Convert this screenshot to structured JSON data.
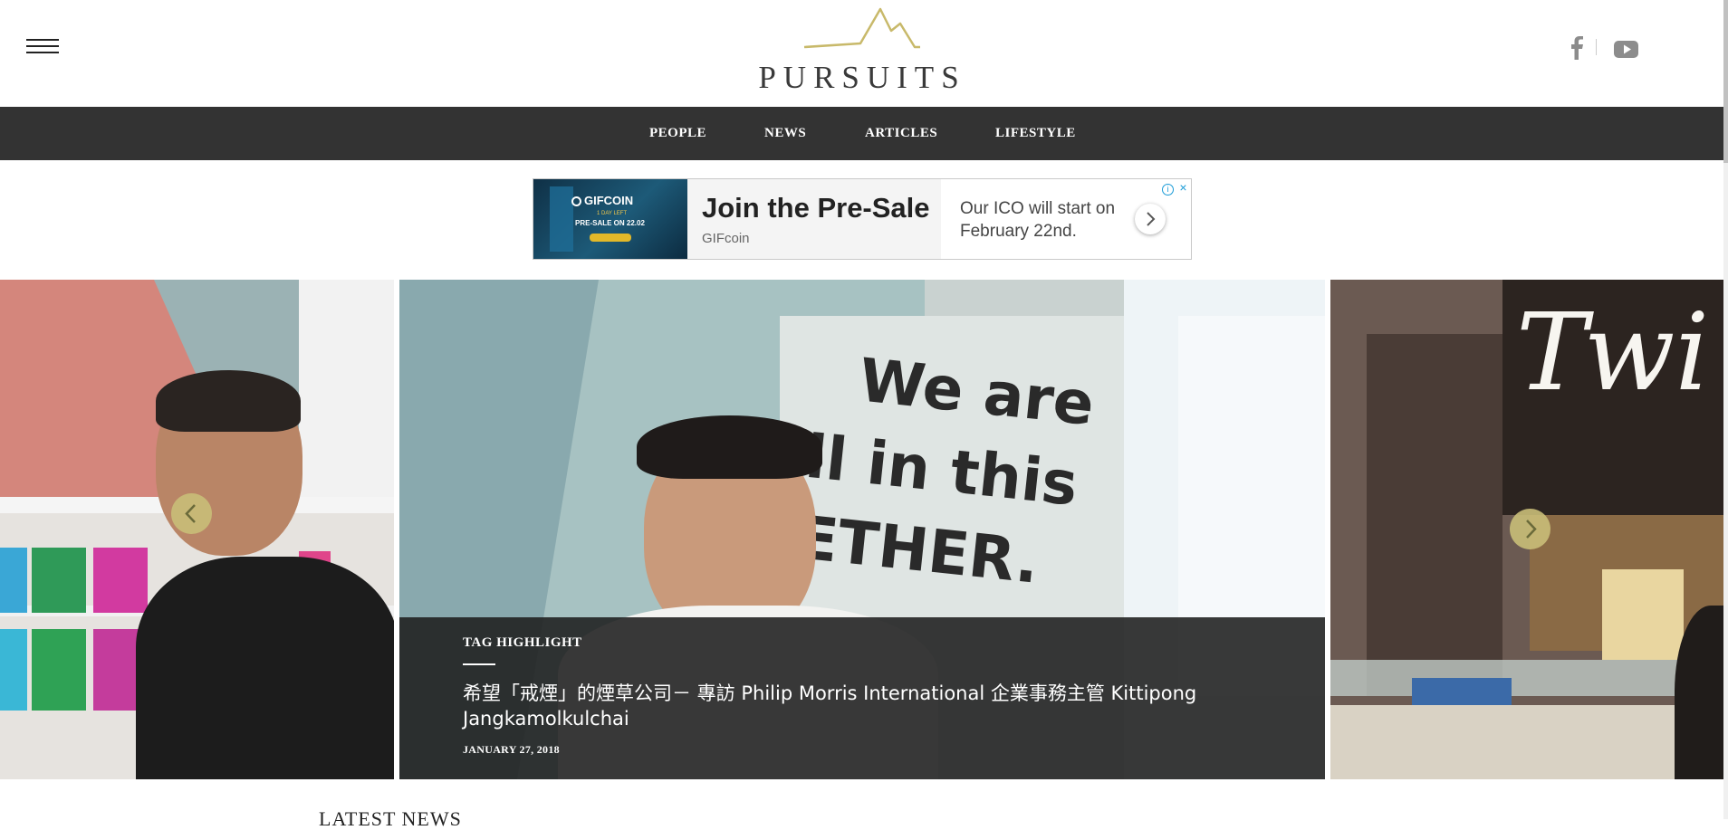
{
  "header": {
    "logo_text": "PURSUITS",
    "brand_color": "#c8b96a",
    "social": [
      {
        "name": "facebook-icon"
      },
      {
        "name": "youtube-icon"
      }
    ]
  },
  "nav": {
    "items": [
      {
        "label": "PEOPLE"
      },
      {
        "label": "NEWS"
      },
      {
        "label": "ARTICLES"
      },
      {
        "label": "LIFESTYLE"
      }
    ],
    "background": "#333333"
  },
  "ad": {
    "image_logo": "GIFCOIN",
    "image_days": "1 DAY LEFT",
    "image_presale": "PRE-SALE ON 22.02",
    "headline": "Join the Pre-Sale",
    "brand": "GIFcoin",
    "description": "Our ICO will start on February 22nd.",
    "badge_info": "i",
    "badge_close": "×"
  },
  "slider": {
    "caption": {
      "tag": "TAG HIGHLIGHT",
      "title": "希望「戒煙」的煙草公司－ 專訪 Philip Morris International 企業事務主管 Kittipong Jangkamolkulchai",
      "date": "JANUARY 27, 2018"
    },
    "center_sign_line1": "We are",
    "center_sign_line2": "ll in this",
    "center_sign_line3": "ETHER.",
    "right_sign": "Twi",
    "arrow_color": "#c9be78"
  },
  "latest_news": {
    "heading": "LATEST NEWS"
  }
}
